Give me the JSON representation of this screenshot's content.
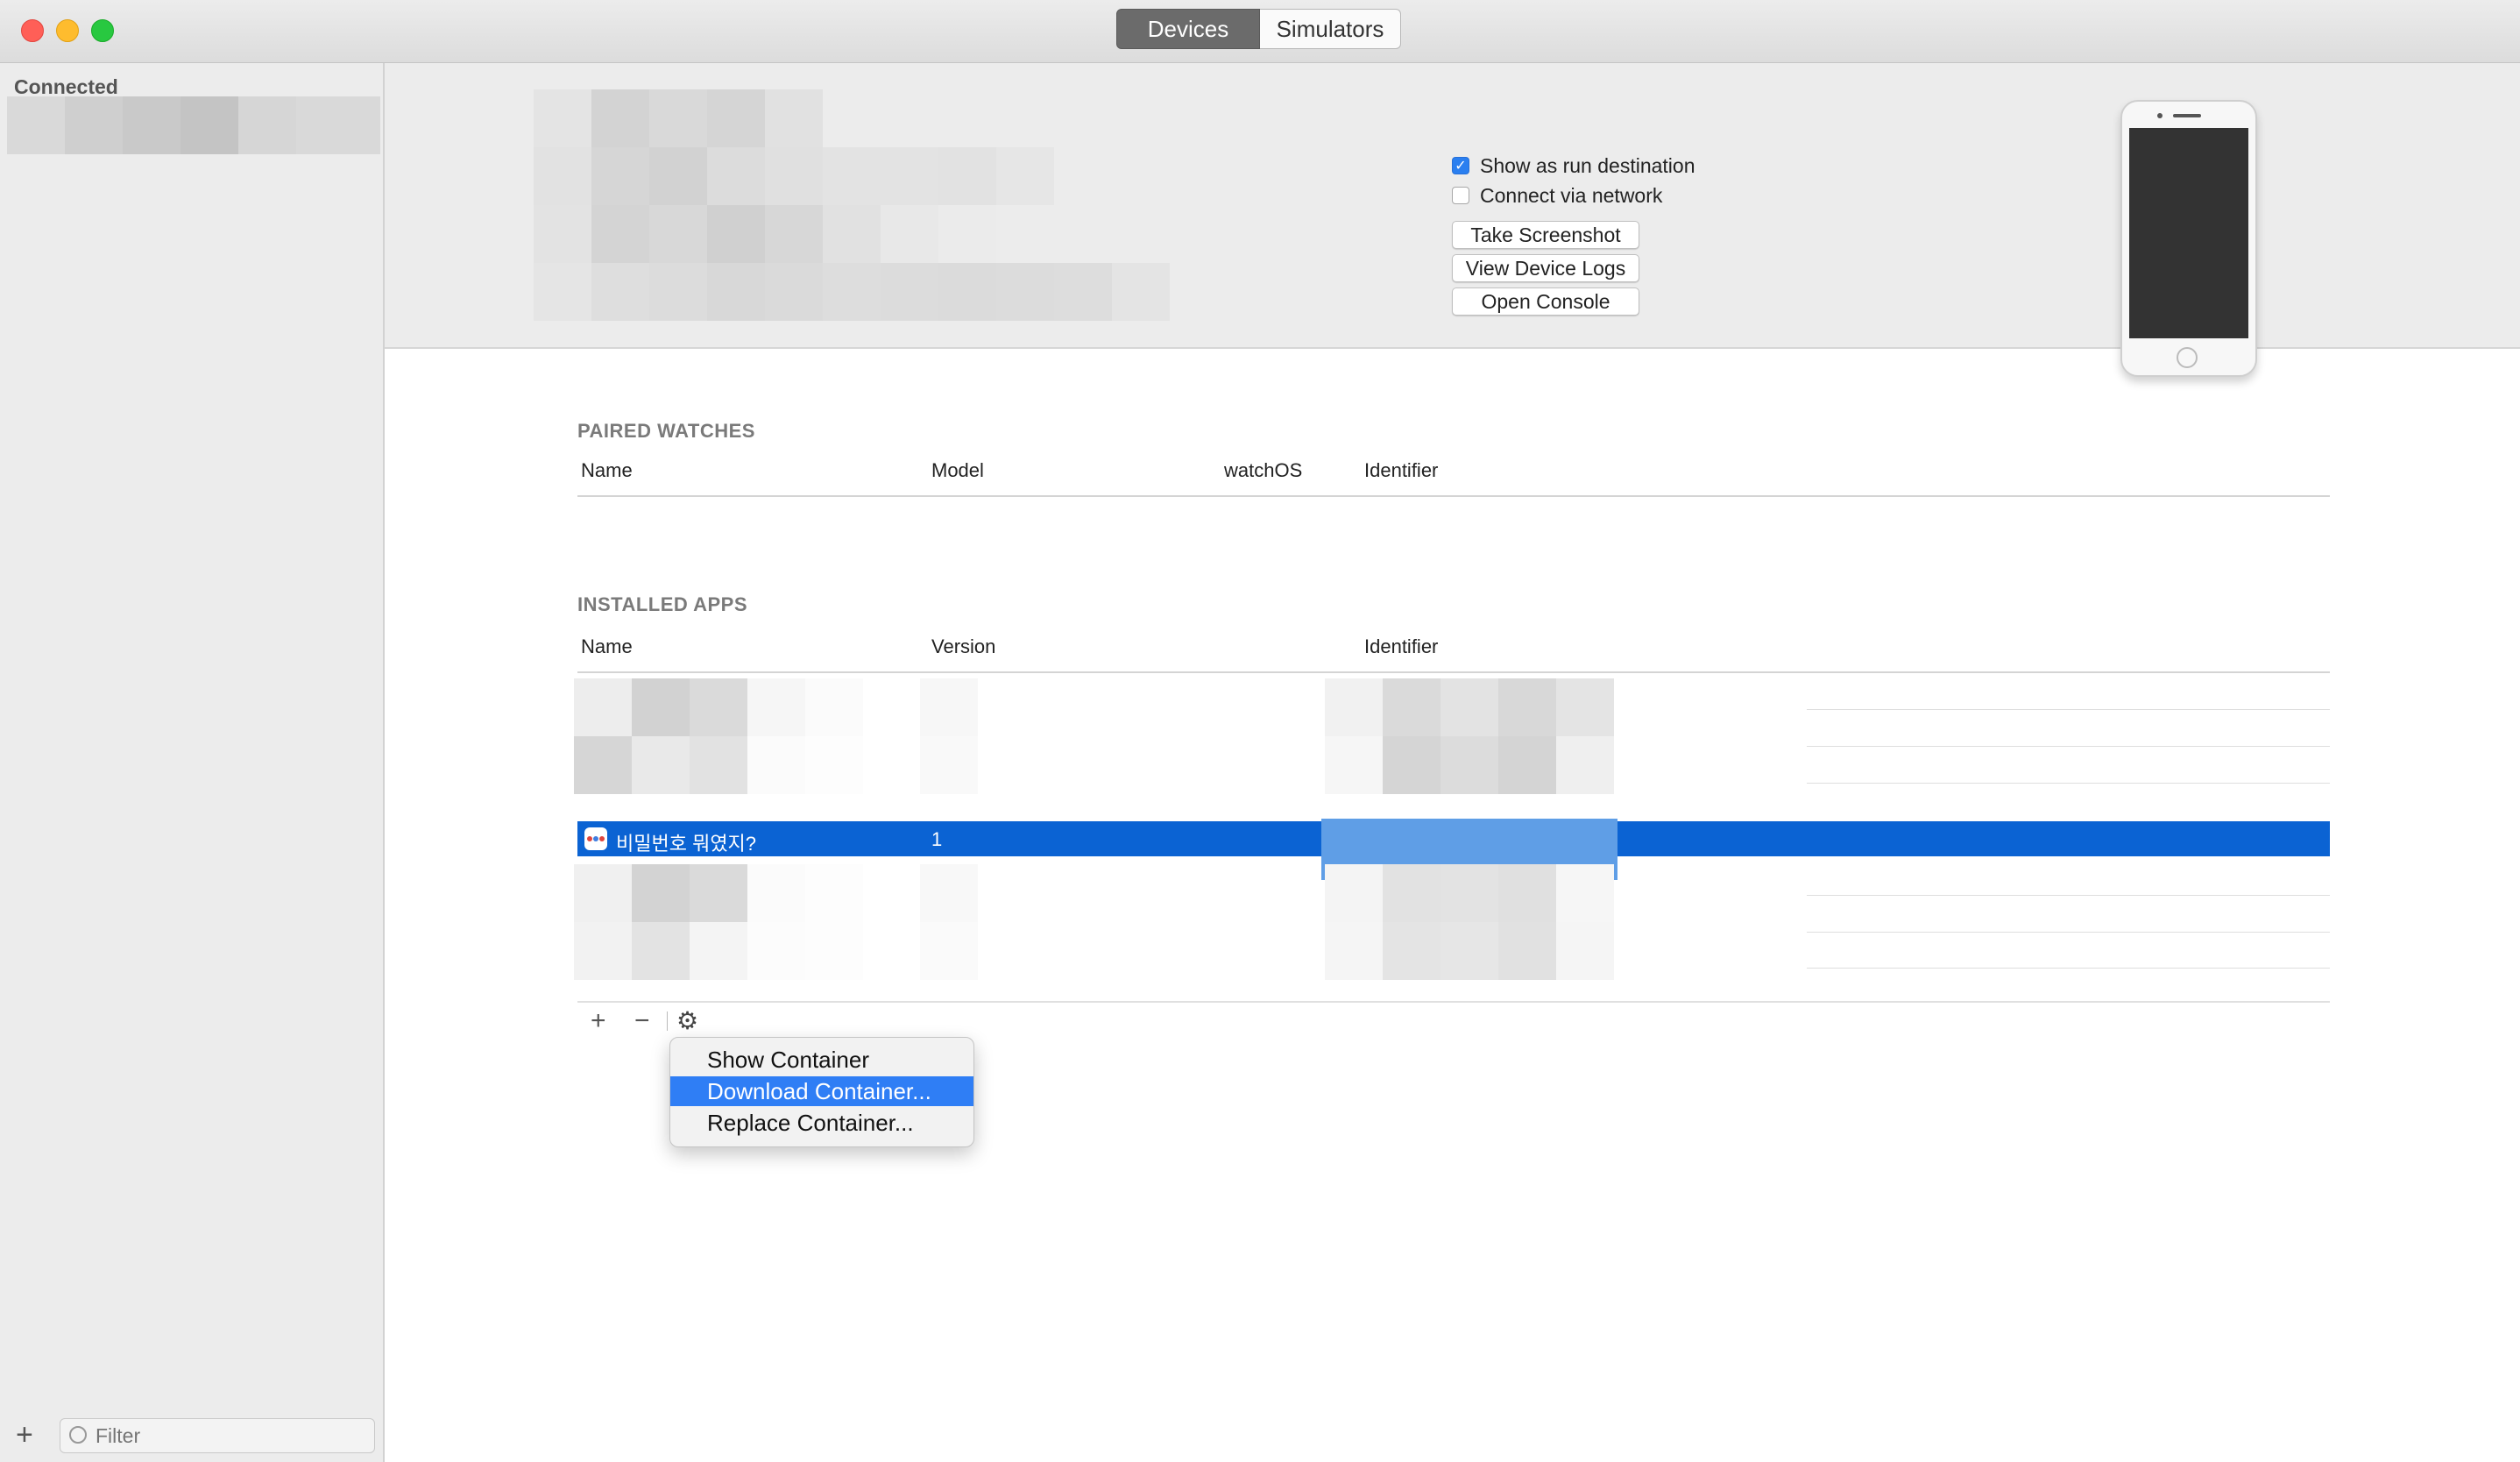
{
  "window": {
    "tabs": [
      {
        "label": "Devices",
        "active": true
      },
      {
        "label": "Simulators",
        "active": false
      }
    ]
  },
  "sidebar": {
    "heading": "Connected",
    "filter_placeholder": "Filter",
    "add_label": "+"
  },
  "device_options": {
    "show_run_destination": {
      "label": "Show as run destination",
      "checked": true
    },
    "connect_network": {
      "label": "Connect via network",
      "checked": false
    },
    "buttons": [
      "Take Screenshot",
      "View Device Logs",
      "Open Console"
    ]
  },
  "paired_watches": {
    "title": "PAIRED WATCHES",
    "columns": [
      "Name",
      "Model",
      "watchOS",
      "Identifier"
    ]
  },
  "installed_apps": {
    "title": "INSTALLED APPS",
    "columns": [
      "Name",
      "Version",
      "Identifier"
    ],
    "selected_app": {
      "name": "비밀번호 뭐였지?",
      "version": "1"
    }
  },
  "toolbar": {
    "add": "+",
    "remove": "−",
    "gear": "⚙"
  },
  "context_menu": {
    "items": [
      {
        "label": "Show Container",
        "highlighted": false
      },
      {
        "label": "Download Container...",
        "highlighted": true
      },
      {
        "label": "Replace Container...",
        "highlighted": false
      }
    ]
  },
  "colors": {
    "selection": "#0b63d3",
    "menu_highlight": "#2f7ef5",
    "checkbox_on": "#2a7ff0"
  }
}
